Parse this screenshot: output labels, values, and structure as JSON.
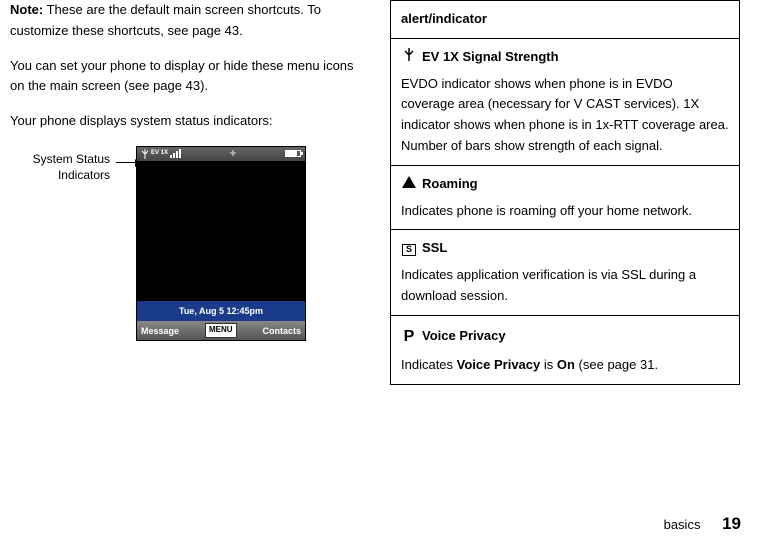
{
  "left": {
    "note_label": "Note:",
    "note_text": " These are the default main screen shortcuts. To customize these shortcuts, see page 43.",
    "para1": "You can set your phone to display or hide these menu icons on the main screen (see page 43).",
    "para2": "Your phone displays system status indicators:",
    "phone_label_line1": "System Status",
    "phone_label_line2": "Indicators",
    "status_bar": {
      "ev1x": "EV 1X"
    },
    "date_time": "Tue, Aug 5  12:45pm",
    "soft_left": "Message",
    "soft_menu": "MENU",
    "soft_right": "Contacts"
  },
  "right": {
    "header": "alert/indicator",
    "row1": {
      "title": "EV 1X  Signal Strength",
      "body": "EVDO indicator shows when phone is in EVDO coverage area (necessary for V CAST services). 1X indicator shows when phone is in 1x-RTT coverage area. Number of bars show strength of each signal."
    },
    "row2": {
      "title": "Roaming",
      "body": "Indicates phone is roaming off your home network."
    },
    "row3": {
      "title": "SSL",
      "body": "Indicates application verification is via SSL during a download session."
    },
    "row4": {
      "title": "Voice Privacy",
      "body_pre": "Indicates ",
      "body_vp": "Voice Privacy",
      "body_mid": " is ",
      "body_on": "On",
      "body_post": " (see page 31."
    }
  },
  "footer": {
    "section": "basics",
    "page": "19"
  }
}
